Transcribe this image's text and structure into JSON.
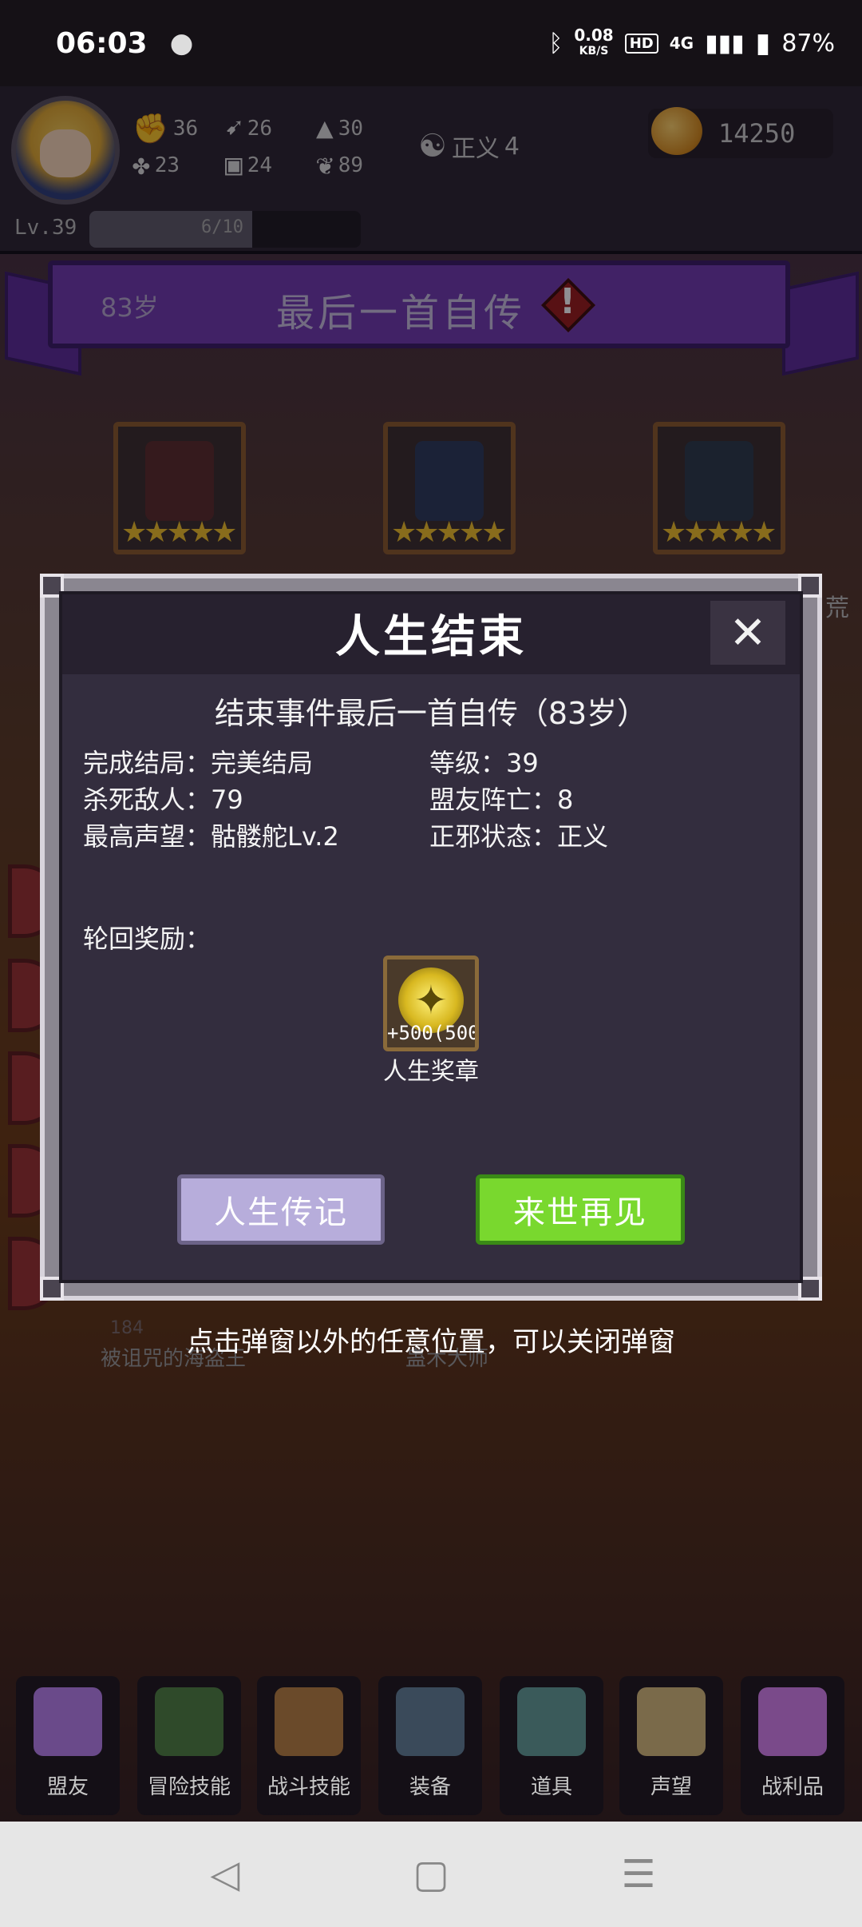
{
  "status_bar": {
    "time": "06:03",
    "network_speed_value": "0.08",
    "network_speed_unit": "KB/S",
    "hd": "HD",
    "network_type": "4G",
    "battery": "87%"
  },
  "header": {
    "stats": [
      {
        "icon": "fist-icon",
        "value": "36"
      },
      {
        "icon": "clover-icon",
        "value": "23"
      },
      {
        "icon": "boot-icon",
        "value": "26"
      },
      {
        "icon": "armor-icon",
        "value": "24"
      },
      {
        "icon": "hat-icon",
        "value": "30"
      },
      {
        "icon": "plant-icon",
        "value": "89"
      }
    ],
    "alignment": {
      "label": "正义",
      "value": "4"
    },
    "gold": "14250",
    "level": "Lv.39",
    "exp": "6/10",
    "exp_fraction": 0.6
  },
  "banner": {
    "age": "83岁",
    "title": "最后一首自传",
    "alert": "!"
  },
  "background": {
    "side_text": "荒",
    "behind_labels": [
      "184",
      "被诅咒的海盗王",
      "蛊术大师"
    ]
  },
  "modal": {
    "title": "人生结束",
    "close": "✕",
    "subtitle": "结束事件最后一首自传（83岁）",
    "info": {
      "ending": "完成结局：完美结局",
      "level": "等级：39",
      "kills": "杀死敌人：79",
      "ally_deaths": "盟友阵亡：8",
      "reputation": "最高声望：骷髅舵Lv.2",
      "alignment": "正邪状态：正义"
    },
    "reward_label": "轮回奖励：",
    "reward": {
      "amount": "+500(500",
      "name": "人生奖章"
    },
    "buttons": {
      "biography": "人生传记",
      "next_life": "来世再见"
    }
  },
  "hint": "点击弹窗以外的任意位置，可以关闭弹窗",
  "bottom_nav": [
    {
      "label": "盟友",
      "color": "#6a4a8a"
    },
    {
      "label": "冒险技能",
      "color": "#2f4a2a"
    },
    {
      "label": "战斗技能",
      "color": "#6a4a2a"
    },
    {
      "label": "装备",
      "color": "#3a4a5a"
    },
    {
      "label": "道具",
      "color": "#3a5a5a"
    },
    {
      "label": "声望",
      "color": "#7a6a4a"
    },
    {
      "label": "战利品",
      "color": "#7a4a8a"
    }
  ],
  "system_nav": {
    "back": "◁",
    "home": "▢",
    "menu": "☰"
  }
}
